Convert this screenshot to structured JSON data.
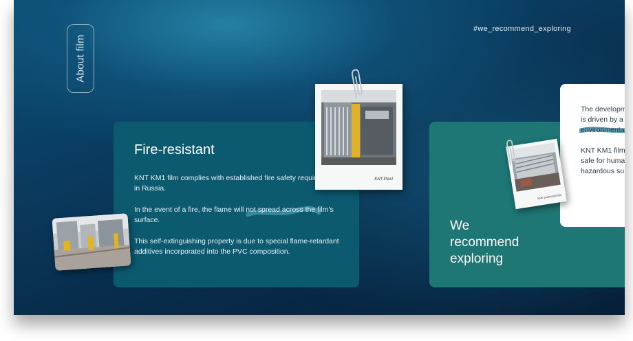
{
  "side_tab": {
    "label": "About film"
  },
  "hashtag": "#we_recommend_exploring",
  "feature_card": {
    "title": "Fire-resistant",
    "p1": "KNT KM1 film complies with established fire safety requirements in Russia.",
    "p2": "In the event of a fire, the flame will not spread across the film's surface.",
    "p3": "This self-extinguishing property is due to special flame-retardant additives incorporated into the PVC composition."
  },
  "recommend_card": {
    "line1": "We",
    "line2": "recommend",
    "line3": "exploring"
  },
  "info_card": {
    "line1": "The developm",
    "line2": "is driven by a f",
    "line3": "environmenta",
    "line4": "KNT KM1 film i",
    "line5": "safe for huma",
    "line6": "hazardous su"
  },
  "polaroid_large": {
    "caption": "KNT-Plast"
  },
  "polaroid_small": {
    "caption": "KNK production line"
  },
  "colors": {
    "background": "#082d4d",
    "feature_card": "#0c5a70",
    "recommend_card": "#1e7675",
    "info_card": "#ffffff",
    "highlight": "#3f8fa6"
  }
}
